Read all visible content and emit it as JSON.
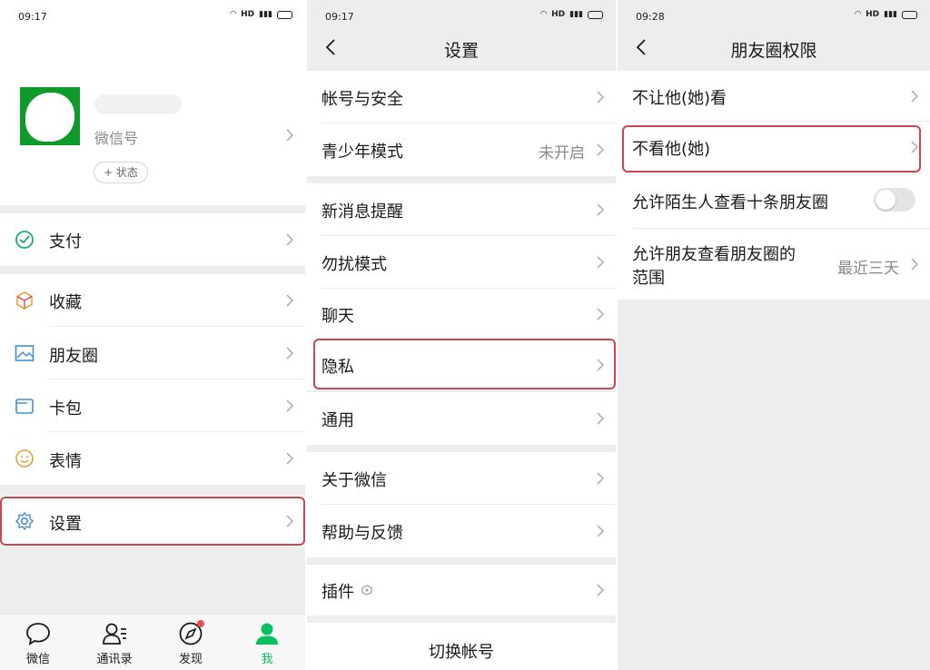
{
  "colors": {
    "brand_green": "#07c160",
    "highlight_red": "#d0454d",
    "background": "#ededed",
    "badge_red": "#f04b4b"
  },
  "panel_me": {
    "status_time": "09:17",
    "status_network": "HD",
    "profile": {
      "wechat_id_label": "微信号",
      "status_button": "+ 状态"
    },
    "menu": {
      "pay": "支付",
      "favorites": "收藏",
      "moments": "朋友圈",
      "cards": "卡包",
      "stickers": "表情",
      "settings": "设置"
    },
    "tabs": [
      {
        "label": "微信",
        "icon": "chat-bubble-icon"
      },
      {
        "label": "通讯录",
        "icon": "contacts-icon"
      },
      {
        "label": "发现",
        "icon": "compass-icon"
      },
      {
        "label": "我",
        "icon": "person-icon"
      }
    ]
  },
  "panel_settings": {
    "status_time": "09:17",
    "status_network": "HD",
    "title": "设置",
    "items": {
      "account_security": "帐号与安全",
      "teen_mode": "青少年模式",
      "teen_mode_value": "未开启",
      "notifications": "新消息提醒",
      "do_not_disturb": "勿扰模式",
      "chat": "聊天",
      "privacy": "隐私",
      "general": "通用",
      "about": "关于微信",
      "help": "帮助与反馈",
      "plugins": "插件",
      "switch_account": "切换帐号"
    }
  },
  "panel_moments": {
    "status_time": "09:28",
    "status_network": "HD",
    "title": "朋友圈权限",
    "items": {
      "hide_from": "不让他(她)看",
      "dont_see": "不看他(她)",
      "allow_strangers": "允许陌生人查看十条朋友圈",
      "allow_strangers_on": false,
      "visible_range_line1": "允许朋友查看朋友圈的",
      "visible_range_line2": "范围",
      "visible_range_value": "最近三天"
    }
  }
}
